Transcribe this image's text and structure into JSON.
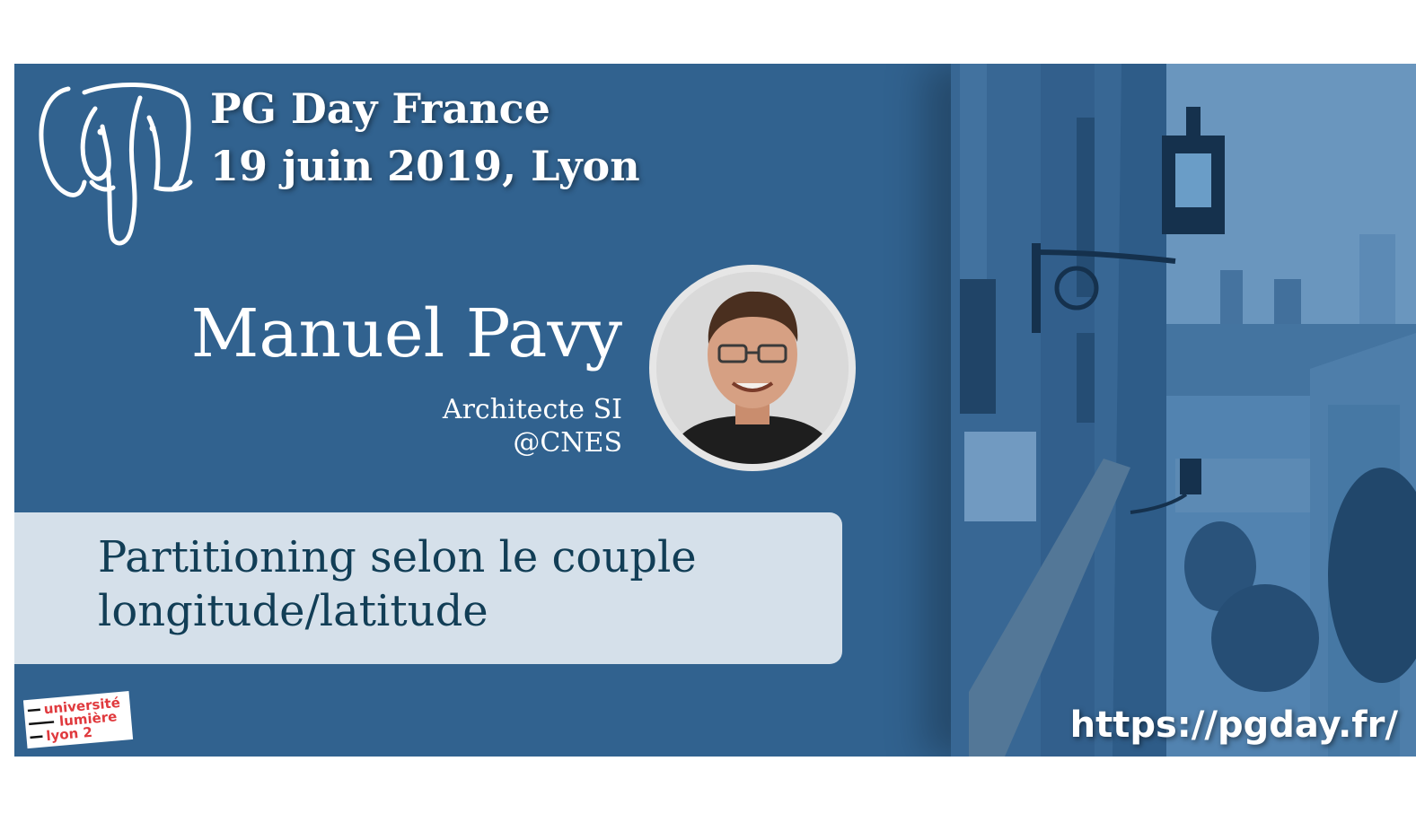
{
  "event": {
    "name": "PG Day France",
    "date_place": "19 juin 2019, Lyon",
    "url": "https://pgday.fr/"
  },
  "speaker": {
    "name": "Manuel Pavy",
    "role": "Architecte SI",
    "org": "@CNES"
  },
  "talk": {
    "title_line1": "Partitioning selon le couple",
    "title_line2": "longitude/latitude"
  },
  "sponsor": {
    "line1": "université",
    "line2": "lumière",
    "line3": "lyon 2"
  },
  "colors": {
    "banner": "#31628f",
    "talk_box": "#d5e0ea",
    "talk_text": "#123e56",
    "sponsor_red": "#e03a3e"
  },
  "icons": [
    "postgresql-elephant-logo",
    "universite-lumiere-lyon2-logo"
  ]
}
